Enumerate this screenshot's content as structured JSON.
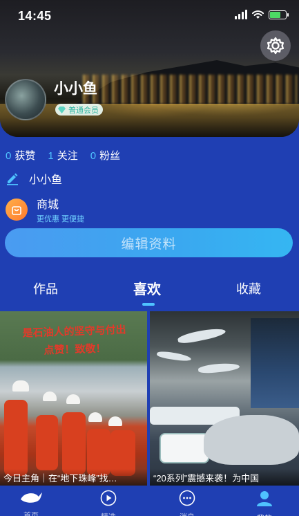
{
  "status": {
    "time": "14:45"
  },
  "profile": {
    "name": "小小鱼",
    "badge": "普通会员",
    "stats": [
      {
        "num": "0",
        "label": "获赞"
      },
      {
        "num": "1",
        "label": "关注"
      },
      {
        "num": "0",
        "label": "粉丝"
      }
    ],
    "nickname": "小小鱼"
  },
  "mall": {
    "title": "商城",
    "subtitle": "更优惠 更便捷"
  },
  "edit_button": "编辑资料",
  "tabs": [
    {
      "label": "作品"
    },
    {
      "label": "喜欢"
    },
    {
      "label": "收藏"
    }
  ],
  "cards": [
    {
      "poster_line1": "是石油人的坚守与付出",
      "poster_line2": "点赞！致敬！",
      "caption": "今日主角｜在“地下珠峰”找…"
    },
    {
      "caption": "“20系列”震撼来袭！为中国"
    }
  ],
  "nav": [
    {
      "label": "首页",
      "icon": "whale-icon"
    },
    {
      "label": "精选",
      "icon": "play-icon"
    },
    {
      "label": "消息",
      "icon": "chat-icon"
    },
    {
      "label": "我的",
      "icon": "user-icon"
    }
  ],
  "colors": {
    "background": "#1f3fb3",
    "accent": "#4fc3ff",
    "button": "#3aa8f0",
    "mall": "#ff8c36"
  }
}
